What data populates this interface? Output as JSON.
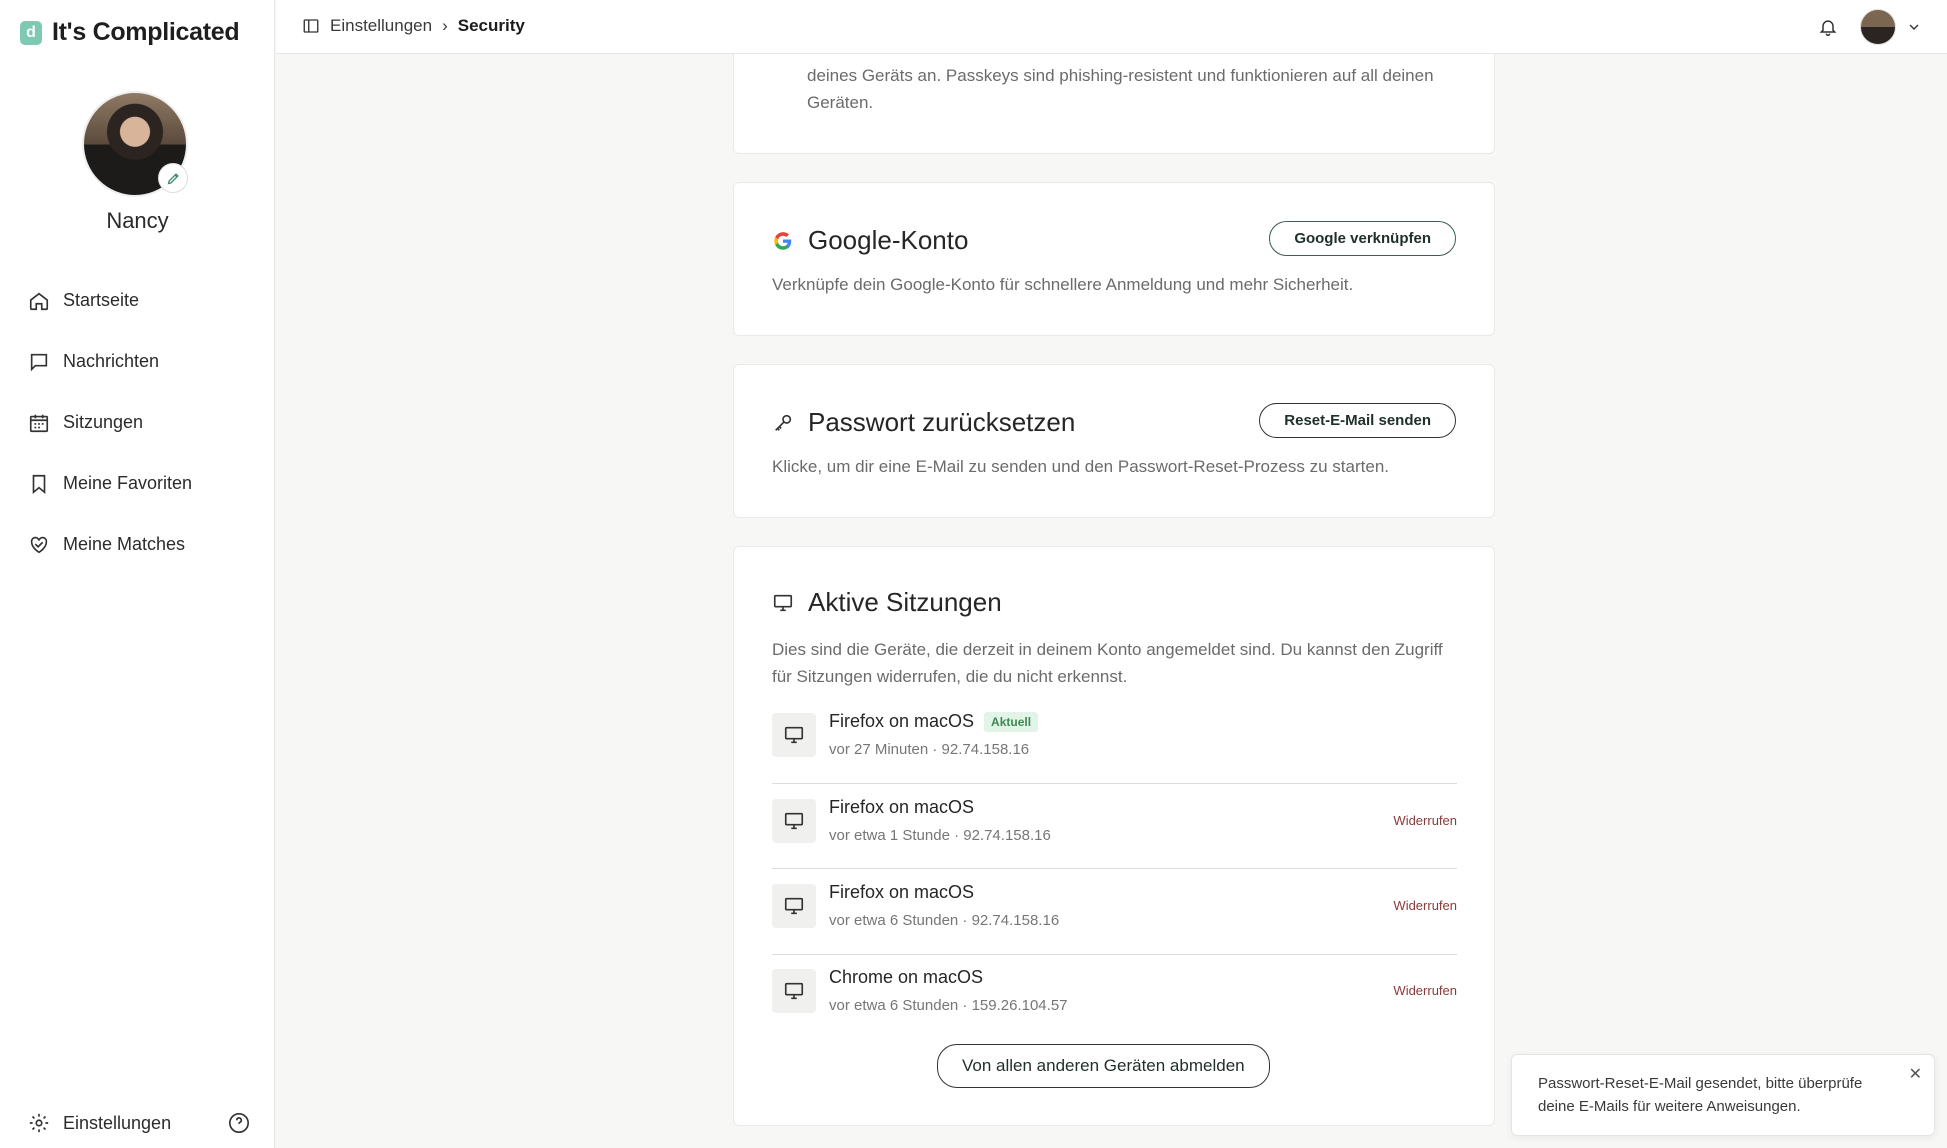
{
  "app": {
    "logo_mark": "d",
    "name": "It's Complicated"
  },
  "user": {
    "name": "Nancy"
  },
  "sidebar": {
    "items": [
      {
        "label": "Startseite",
        "icon": "home-icon"
      },
      {
        "label": "Nachrichten",
        "icon": "message-icon"
      },
      {
        "label": "Sitzungen",
        "icon": "calendar-icon"
      },
      {
        "label": "Meine Favoriten",
        "icon": "bookmark-icon"
      },
      {
        "label": "Meine Matches",
        "icon": "heart-handshake-icon"
      }
    ],
    "footer_settings": "Einstellungen"
  },
  "breadcrumb": {
    "parent": "Einstellungen",
    "separator": "›",
    "current": "Security"
  },
  "passkey": {
    "desc": "deines Geräts an. Passkeys sind phishing-resistent und funktionieren auf all deinen Geräten."
  },
  "google": {
    "title": "Google-Konto",
    "button": "Google verknüpfen",
    "desc": "Verknüpfe dein Google-Konto für schnellere Anmeldung und mehr Sicherheit."
  },
  "password": {
    "title": "Passwort zurücksetzen",
    "button": "Reset-E-Mail senden",
    "desc": "Klicke, um dir eine E-Mail zu senden und den Passwort-Reset-Prozess zu starten."
  },
  "sessions": {
    "title": "Aktive Sitzungen",
    "desc": "Dies sind die Geräte, die derzeit in deinem Konto angemeldet sind. Du kannst den Zugriff für Sitzungen widerrufen, die du nicht erkennst.",
    "current_badge": "Aktuell",
    "revoke_label": "Widerrufen",
    "items": [
      {
        "name": "Firefox on macOS",
        "meta": "vor 27 Minuten · 92.74.158.16"
      },
      {
        "name": "Firefox on macOS",
        "meta": "vor etwa 1 Stunde · 92.74.158.16"
      },
      {
        "name": "Firefox on macOS",
        "meta": "vor etwa 6 Stunden · 92.74.158.16"
      },
      {
        "name": "Chrome on macOS",
        "meta": "vor etwa 6 Stunden · 159.26.104.57"
      }
    ],
    "logout_all": "Von allen anderen Geräten abmelden"
  },
  "toast": {
    "text": "Passwort-Reset-E-Mail gesendet, bitte überprüfe deine E-Mails für weitere Anweisungen.",
    "close": "✕"
  },
  "colors": {
    "brand": "#7ec9b4",
    "accent_border": "#3f5d52",
    "revoke": "#8a3a3a",
    "badge_bg": "#e2f3e7"
  }
}
